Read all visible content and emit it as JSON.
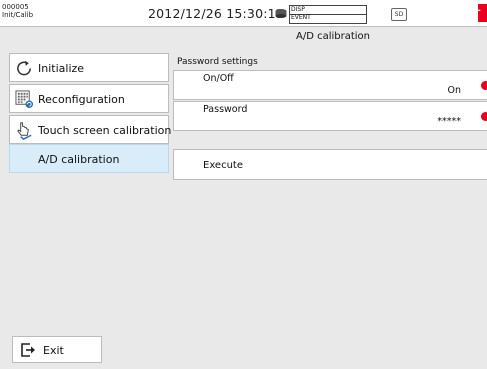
{
  "status_bar": {
    "id_line1": "000005",
    "id_line2": "Init/Calib",
    "datetime": "2012/12/26 15:30:13",
    "mode_line1": "DISP",
    "mode_line2": "EVENT",
    "sd_label": "SD",
    "alarm_color": "#e8001c"
  },
  "page_title": "A/D calibration",
  "menu": {
    "items": [
      {
        "label": "Initialize",
        "icon": "refresh-icon"
      },
      {
        "label": "Reconfiguration",
        "icon": "reconfiguration-icon"
      },
      {
        "label": "Touch screen calibration",
        "icon": "touch-hand-icon"
      },
      {
        "label": "A/D calibration",
        "icon": "",
        "selected": true
      }
    ]
  },
  "password_settings": {
    "section_label": "Password settings",
    "on_off": {
      "name": "On/Off",
      "value": "On"
    },
    "password": {
      "name": "Password",
      "value": "*****"
    }
  },
  "execute_label": "Execute",
  "exit_label": "Exit",
  "colors": {
    "selected_bg": "#d8ecfa",
    "pin": "#e8001c",
    "background": "#e9e9e9"
  }
}
